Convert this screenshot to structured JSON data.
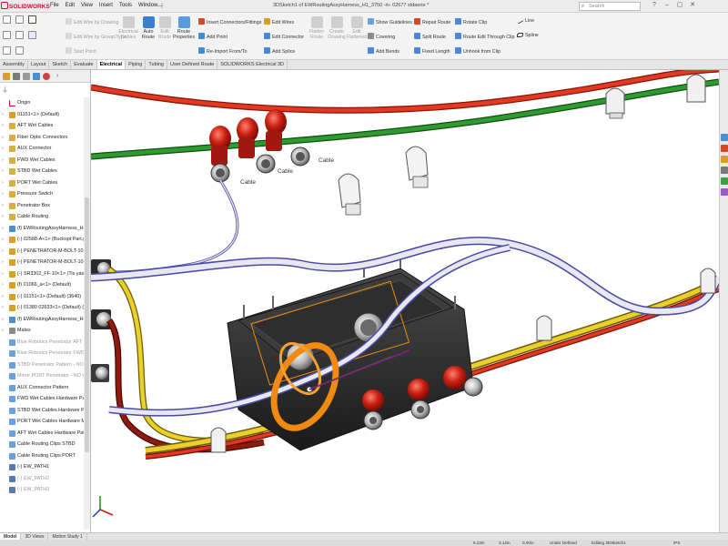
{
  "app": {
    "logo_text": "SOLIDWORKS",
    "brand_color": "#c8102e"
  },
  "menu": [
    "File",
    "Edit",
    "View",
    "Insert",
    "Tools",
    "Window"
  ],
  "document_title": "3DSketch1 of EWRoutingAssyHarness_H1_3750 -in- 02677 xtdaerie *",
  "search": {
    "placeholder": "Search"
  },
  "window_controls": [
    "?",
    "–",
    "▢",
    "✕"
  ],
  "command_manager": {
    "group1": [
      "Edit Wire by Drawing",
      "Edit Wire by Group/Type",
      "Start Point"
    ],
    "big_buttons": [
      "Electrical Cables",
      "Auto Route",
      "Edit Route",
      "Route Properties"
    ],
    "group2": [
      "Insert Connectors/Fittings",
      "Add Point",
      "Re-Import From/To"
    ],
    "group3": [
      "Edit Wires",
      "Edit Connector",
      "Add Splice"
    ],
    "big_buttons2": [
      "Flatten Route",
      "Create Drawing",
      "Edit Flattened"
    ],
    "group4": [
      "Show Guidelines",
      "Covering",
      "Add Bends"
    ],
    "group5": [
      "Repair Route",
      "Split Route",
      "Fixed Length"
    ],
    "group6": [
      "Rotate Clip",
      "Route Edit Through Clip",
      "Unhook from Clip"
    ],
    "group7": [
      "Line",
      "Spline"
    ]
  },
  "tabs": [
    {
      "label": "Assembly",
      "active": false
    },
    {
      "label": "Layout",
      "active": false
    },
    {
      "label": "Sketch",
      "active": false
    },
    {
      "label": "Evaluate",
      "active": false
    },
    {
      "label": "Electrical",
      "active": true
    },
    {
      "label": "Piping",
      "active": false
    },
    {
      "label": "Tubing",
      "active": false
    },
    {
      "label": "User Defined Route",
      "active": false
    },
    {
      "label": "SOLIDWORKS Electrical 3D",
      "active": false
    }
  ],
  "tree": [
    {
      "label": "Origin",
      "icon": "origin-icon",
      "expandable": false,
      "gray": false
    },
    {
      "label": "01151<1> (Default)",
      "icon": "part-icon",
      "expandable": true,
      "gray": false
    },
    {
      "label": "AFT Wet Cables",
      "icon": "folder-icon",
      "expandable": true,
      "gray": false
    },
    {
      "label": "Fiber Optic Connectors",
      "icon": "folder-icon",
      "expandable": true,
      "gray": false
    },
    {
      "label": "AUX Connector",
      "icon": "folder-icon",
      "expandable": true,
      "gray": false
    },
    {
      "label": "FWD Wet Cables",
      "icon": "folder-icon",
      "expandable": true,
      "gray": false
    },
    {
      "label": "STBD Wet Cables",
      "icon": "folder-icon",
      "expandable": true,
      "gray": false
    },
    {
      "label": "PORT Wet Cables",
      "icon": "folder-icon",
      "expandable": true,
      "gray": false
    },
    {
      "label": "Pressure Switch",
      "icon": "folder-icon",
      "expandable": true,
      "gray": false
    },
    {
      "label": "Penetrator Box",
      "icon": "folder-icon",
      "expandable": true,
      "gray": false
    },
    {
      "label": "Cable Routing",
      "icon": "folder-icon",
      "expandable": true,
      "gray": false
    },
    {
      "label": "(f) EWRoutingAssyHarness_H1_3(",
      "icon": "assembly-icon",
      "expandable": true,
      "gray": false
    },
    {
      "label": "(-) 02588-A<1> (Buckopt Part.pr",
      "icon": "part-icon",
      "expandable": true,
      "gray": false
    },
    {
      "label": "(-) PENETRATOR-M-BOLT-10-25",
      "icon": "part-icon",
      "expandable": true,
      "gray": false
    },
    {
      "label": "(-) PENETRATOR-M-BOLT-10-25",
      "icon": "part-icon",
      "expandable": true,
      "gray": false
    },
    {
      "label": "(-) SR3302_FF-10<1> (Tis yaseri",
      "icon": "part-icon",
      "expandable": true,
      "gray": false
    },
    {
      "label": "(f) 01066_a<1> (Default)",
      "icon": "part-icon",
      "expandable": true,
      "gray": false
    },
    {
      "label": "(-) 01151<1> (Default) (3640)",
      "icon": "part-icon",
      "expandable": true,
      "gray": false
    },
    {
      "label": "(-) 01380 02633<1> (Default) (3787)",
      "icon": "part-icon",
      "expandable": true,
      "gray": false
    },
    {
      "label": "(f) EWRoutingAssyHarness_H1_3(",
      "icon": "assembly-icon",
      "expandable": true,
      "gray": false
    },
    {
      "label": "Mates",
      "icon": "mates-icon",
      "expandable": true,
      "gray": false
    },
    {
      "label": "Blue Robotics Penetrator AFT - N",
      "icon": "pattern-icon",
      "expandable": false,
      "gray": true
    },
    {
      "label": "Blue Robotics Penetrator FWD - N",
      "icon": "pattern-icon",
      "expandable": false,
      "gray": true
    },
    {
      "label": "STBD Penetrator Pattern - NO WE",
      "icon": "pattern-icon",
      "expandable": false,
      "gray": true
    },
    {
      "label": "Mirror PORT Penetrator - NO WE",
      "icon": "pattern-icon",
      "expandable": false,
      "gray": true
    },
    {
      "label": "AUX Connector Pattern",
      "icon": "pattern-icon",
      "expandable": false,
      "gray": false
    },
    {
      "label": "FWD Wet Cables Hardware Patter",
      "icon": "pattern-icon",
      "expandable": false,
      "gray": false
    },
    {
      "label": "STBD Wet Cables Hardware Patte",
      "icon": "pattern-icon",
      "expandable": false,
      "gray": false
    },
    {
      "label": "PORT Wet Cables Hardware Mirror",
      "icon": "pattern-icon",
      "expandable": false,
      "gray": false
    },
    {
      "label": "AFT Wet Cables Hardware Patter",
      "icon": "pattern-icon",
      "expandable": false,
      "gray": false
    },
    {
      "label": "Cable Routing Clips STBD",
      "icon": "pattern-icon",
      "expandable": false,
      "gray": false
    },
    {
      "label": "Cable Routing Clips PORT",
      "icon": "pattern-icon",
      "expandable": false,
      "gray": false
    },
    {
      "label": "(-) EW_PATH1",
      "icon": "sketch-icon",
      "expandable": false,
      "gray": false
    },
    {
      "label": "(-) EW_PATH2",
      "icon": "sketch-icon",
      "expandable": false,
      "gray": true
    },
    {
      "label": "(-) EW_PATH3",
      "icon": "sketch-icon",
      "expandable": false,
      "gray": true
    }
  ],
  "viewport_labels": {
    "cable_1": "Cable",
    "cable_2": "Cable",
    "cable_3": "Cable"
  },
  "bottom_tabs": [
    {
      "label": "Model",
      "active": true
    },
    {
      "label": "3D Views",
      "active": false
    },
    {
      "label": "Motion Study 1",
      "active": false
    }
  ],
  "status": {
    "coords": "6.23in",
    "coords2": "3.12in",
    "coords3": "0.00in",
    "state": "Under Defined",
    "editing": "Editing 3DSketch1",
    "units": "IPS"
  },
  "colors": {
    "wire_red": "#d42a1a",
    "wire_green": "#2a8a2a",
    "wire_yellow": "#e8c21a",
    "wire_darkred": "#8a1a10",
    "cable_white": "#e4e4ec",
    "cable_blue_outline": "#6a6ab8",
    "selection_orange": "#f08a10",
    "housing": "#2b2b2b"
  }
}
